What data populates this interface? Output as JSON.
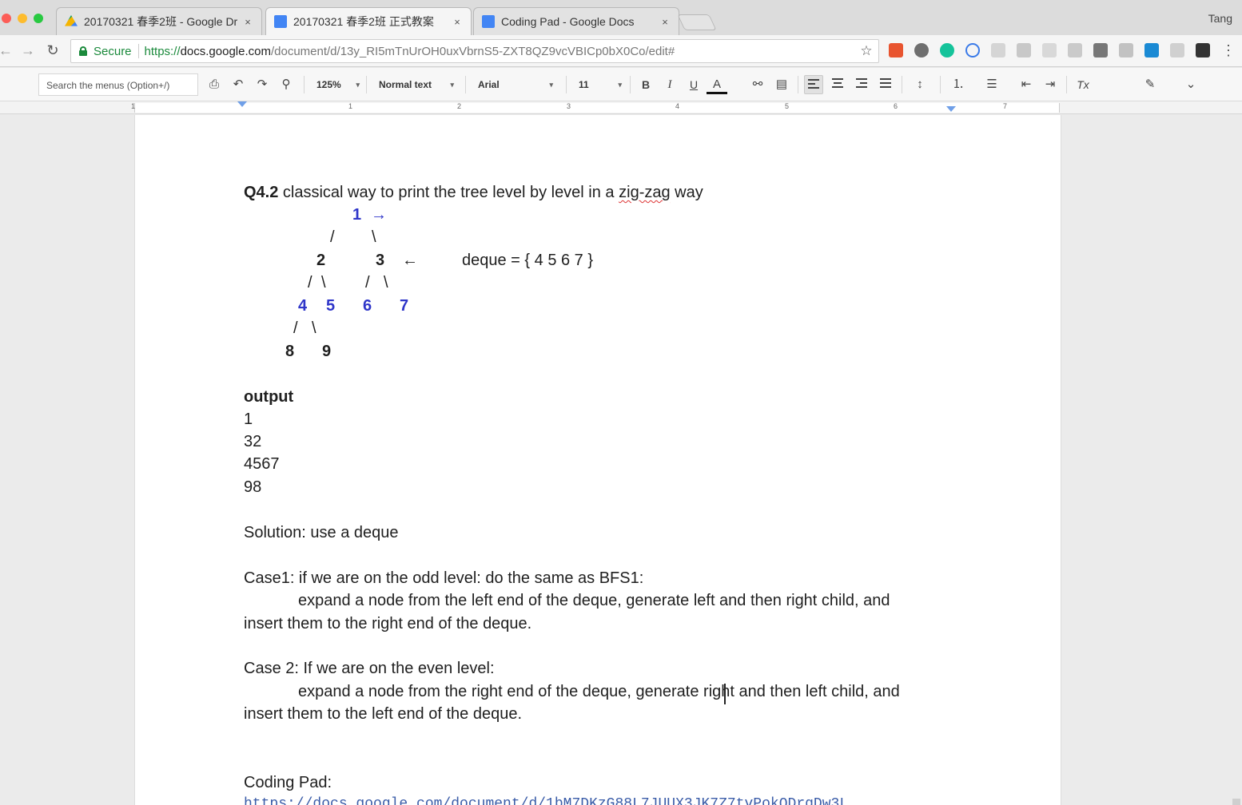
{
  "browser": {
    "tabs": [
      {
        "title": "20170321 春季2班 - Google Dr",
        "close": "×",
        "icon_color": "#f4b400"
      },
      {
        "title": "20170321 春季2班 正式教案",
        "close": "×",
        "icon_color": "#4285f4"
      },
      {
        "title": "Coding Pad - Google Docs",
        "close": "×",
        "icon_color": "#4285f4"
      }
    ],
    "profile": "Tang",
    "security_label": "Secure",
    "url_scheme": "https://",
    "url_host": "docs.google.com",
    "url_path": "/document/d/13y_RI5mTnUrOH0uxVbrnS5-ZXT8QZ9vcVBICp0bX0Co/edit#",
    "icons": {
      "back": "←",
      "forward": "→",
      "reload": "↻",
      "bookmark": "☆",
      "menu": "⋮"
    }
  },
  "toolbar": {
    "search_menus": "Search the menus (Option+/)",
    "zoom": "125%",
    "style": "Normal text",
    "font": "Arial",
    "size": "11",
    "bold": "B",
    "italic": "I",
    "underline": "U",
    "text_color": "A",
    "clear_format": "Tx",
    "icons": {
      "print": "⎙",
      "undo": "↶",
      "redo": "↷",
      "paint_format": "⚲",
      "link": "⚯",
      "comment": "▤",
      "line_spacing": "↕",
      "numbered_list": "⒈",
      "bulleted_list": "☰",
      "decrease_indent": "⇤",
      "increase_indent": "⇥",
      "pencil": "✎",
      "collapse": "⌄"
    }
  },
  "ruler": {
    "numbers": [
      "1",
      "1",
      "2",
      "3",
      "4",
      "5",
      "6",
      "7"
    ]
  },
  "document": {
    "heading_label": "Q4.2",
    "heading_text": " classical way to print the tree level by level in a ",
    "heading_squiggle": "zig-zag",
    "heading_end": " way",
    "tree": {
      "root": "1",
      "root_arrow": "→",
      "edge_l1_left": "/",
      "edge_l1_right": "\\",
      "level2_left": "2",
      "level2_right": "3",
      "level2_arrow": "←",
      "deque_label": "deque = { 4  5  6  7 }",
      "edge_l2_a": "/",
      "edge_l2_b": "\\",
      "edge_l2_c": "/",
      "edge_l2_d": "\\",
      "level3": [
        "4",
        "5",
        "6",
        "7"
      ],
      "edge_l3_a": "/",
      "edge_l3_b": "\\",
      "level4": [
        "8",
        "9"
      ]
    },
    "output_label": "output",
    "output_lines": [
      "1",
      "32",
      "4567",
      "98"
    ],
    "solution": "Solution: use a deque",
    "case1_title": "Case1: if we are on the odd level: do the same as BFS1:",
    "case1_line1": "expand a node from the left end of the deque, generate left and then right child, and",
    "case1_line2": "insert them to the right end of the deque.",
    "case2_title": "Case 2: If we are on the even level:",
    "case2_line1": "expand a node from the right end of the deque, generate right and then left child, and",
    "case2_line2": "insert them to the left end of the deque.",
    "coding_pad_label": "Coding Pad:",
    "coding_pad_link": "https://docs.google.com/document/d/1bM7DKzG88L7JUUX3JK7Z7tvPokQDrgDw3L"
  }
}
